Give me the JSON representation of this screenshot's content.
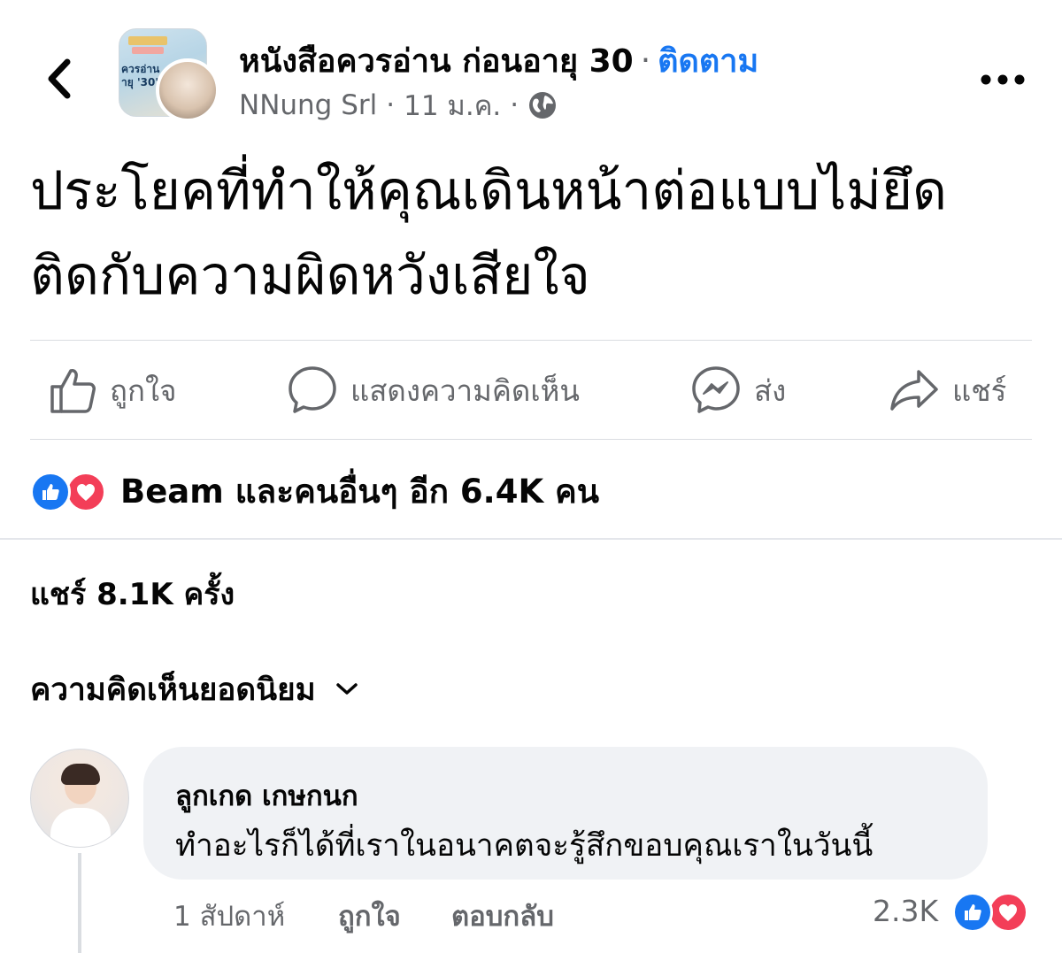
{
  "header": {
    "group_name": "หนังสือควรอ่าน ก่อนอายุ 30",
    "separator": "·",
    "follow_label": "ติดตาม",
    "author": "NNung Srl",
    "date": "11 ม.ค.",
    "thumb_text": "ควรอ่าน\nายุ '30'",
    "icons": {
      "back": "chevron-left-icon",
      "privacy": "globe-icon",
      "more": "more-horizontal-icon"
    }
  },
  "post": {
    "text_line1": "ประโยคที่ทำให้คุณเดินหน้าต่อแบบไม่ยึด",
    "text_line2": "ติดกับความผิดหวังเสียใจ"
  },
  "actions": {
    "like_label": "ถูกใจ",
    "comment_label": "แสดงความคิดเห็น",
    "send_label": "ส่ง",
    "share_label": "แชร์"
  },
  "reactions": {
    "summary": "Beam และคนอื่นๆ อีก 6.4K คน",
    "types": [
      "like",
      "love"
    ]
  },
  "shares": {
    "text": "แชร์ 8.1K ครั้ง"
  },
  "comments": {
    "sort_label": "ความคิดเห็นยอดนิยม",
    "items": [
      {
        "author": "ลูกเกด เกษกนก",
        "text": "ทำอะไรก็ได้ที่เราในอนาคตจะรู้สึกขอบคุณเราในวันนี้",
        "time": "1 สัปดาห์",
        "like_label": "ถูกใจ",
        "reply_label": "ตอบกลับ",
        "reaction_count": "2.3K"
      }
    ]
  },
  "colors": {
    "accent": "#1877f2",
    "love": "#f33e58",
    "secondary_text": "#65676b",
    "bubble": "#f0f2f5"
  }
}
